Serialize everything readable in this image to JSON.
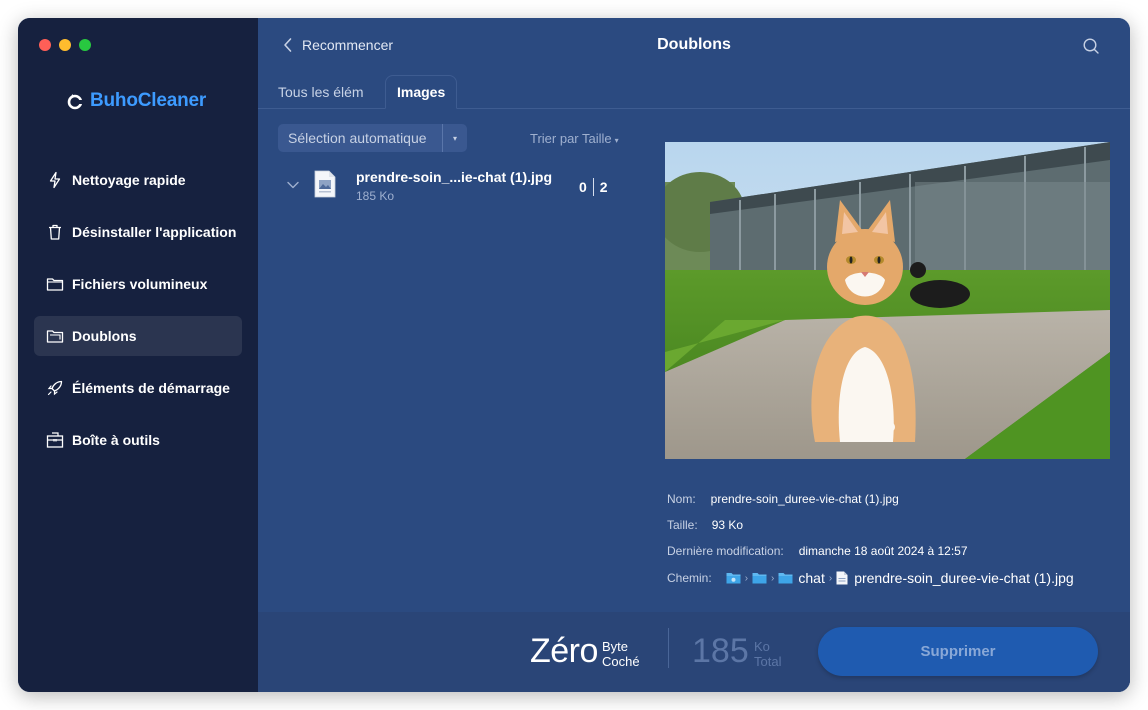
{
  "app": {
    "name": "BuhoCleaner"
  },
  "sidebar": {
    "items": [
      {
        "label": "Nettoyage rapide",
        "icon": "lightning-icon"
      },
      {
        "label": "Désinstaller l'application",
        "icon": "trash-icon"
      },
      {
        "label": "Fichiers volumineux",
        "icon": "folder-icon"
      },
      {
        "label": "Doublons",
        "icon": "duplicate-folder-icon",
        "active": true
      },
      {
        "label": "Éléments de démarrage",
        "icon": "rocket-icon"
      },
      {
        "label": "Boîte à outils",
        "icon": "toolbox-icon"
      }
    ]
  },
  "header": {
    "back_label": "Recommencer",
    "title": "Doublons"
  },
  "tabs": [
    {
      "label": "Tous les élém",
      "selected": false
    },
    {
      "label": "Images",
      "selected": true
    }
  ],
  "toolbar": {
    "selection": "Sélection automatique",
    "sort": "Trier par Taille"
  },
  "file_list": [
    {
      "name": "prendre-soin_...ie-chat (1).jpg",
      "size": "185 Ko",
      "checked": "0",
      "total": "2"
    }
  ],
  "details": {
    "name_label": "Nom:",
    "name_value": "prendre-soin_duree-vie-chat (1).jpg",
    "size_label": "Taille:",
    "size_value": "93 Ko",
    "modified_label": "Dernière modification:",
    "modified_value": "dimanche 18 août 2024 à 12:57",
    "path_label": "Chemin:",
    "path_folder": "chat",
    "path_file": "prendre-soin_duree-vie-chat (1).jpg"
  },
  "footer": {
    "checked_value": "Zéro",
    "checked_unit": "Byte",
    "checked_label": "Coché",
    "total_value": "185",
    "total_unit": "Ko",
    "total_label": "Total",
    "delete_label": "Supprimer"
  },
  "colors": {
    "accent": "#3d9bff",
    "sidebar_bg": "#16213f",
    "main_bg": "#2b4a80",
    "button": "#1f5bb0"
  }
}
